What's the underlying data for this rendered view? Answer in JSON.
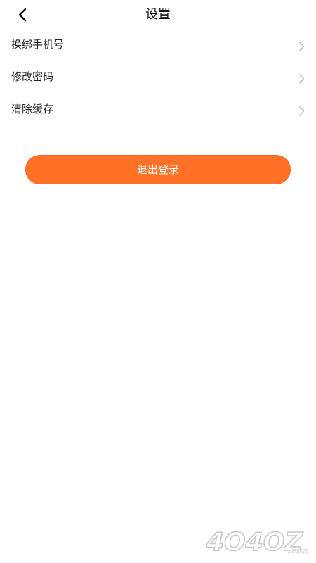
{
  "header": {
    "title": "设置",
    "back_icon": "chevron-left-icon"
  },
  "menu": {
    "items": [
      {
        "label": "换绑手机号",
        "icon": "chevron-right-icon"
      },
      {
        "label": "修改密码",
        "icon": "chevron-right-icon"
      },
      {
        "label": "清除缓存",
        "icon": "chevron-right-icon"
      }
    ]
  },
  "logout": {
    "label": "退出登录",
    "color": "#ff7127"
  },
  "watermark": {
    "text": "4O4OZ.com"
  }
}
